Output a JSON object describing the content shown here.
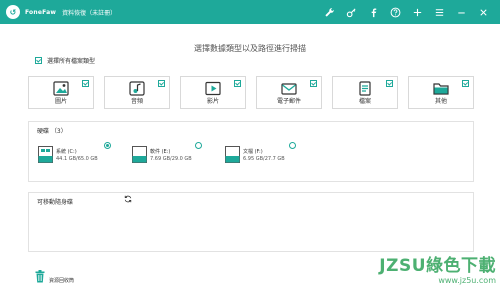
{
  "titlebar": {
    "brand": "FoneFaw",
    "title": "資料恢復（未註冊）",
    "icons": [
      "wrench-icon",
      "key-icon",
      "facebook-icon",
      "help-icon",
      "plus-icon",
      "menu-icon",
      "minimize-icon",
      "close-icon"
    ]
  },
  "heading": "選擇數據類型以及路徑進行掃描",
  "select_all": {
    "label": "選擇所有檔案類型",
    "checked": true
  },
  "file_types": [
    {
      "label": "圖片",
      "icon": "image-icon",
      "checked": true
    },
    {
      "label": "音頻",
      "icon": "music-icon",
      "checked": true
    },
    {
      "label": "影片",
      "icon": "video-icon",
      "checked": true
    },
    {
      "label": "電子郵件",
      "icon": "mail-icon",
      "checked": true
    },
    {
      "label": "檔案",
      "icon": "document-icon",
      "checked": true
    },
    {
      "label": "其他",
      "icon": "folder-icon",
      "checked": true
    }
  ],
  "hdd": {
    "title": "硬碟 （3）",
    "drives": [
      {
        "name": "系統 (C:)",
        "size": "44.1 GB/65.0 GB",
        "selected": true,
        "icon": "windows-drive-icon"
      },
      {
        "name": "軟件 (E:)",
        "size": "7.69 GB/29.0 GB",
        "selected": false,
        "icon": "drive-icon"
      },
      {
        "name": "文檔 (F:)",
        "size": "6.95 GB/27.7 GB",
        "selected": false,
        "icon": "drive-icon"
      }
    ]
  },
  "removable": {
    "title": "可移動隨身碟",
    "refresh_icon": "refresh-icon"
  },
  "recycle": {
    "label": "資源回收筒",
    "icon": "trash-icon"
  },
  "watermark": {
    "main": "JZSU綠色下載",
    "url": "www.jz5u.com"
  },
  "colors": {
    "accent": "#1ea99a",
    "watermark": "#2fa35a"
  }
}
